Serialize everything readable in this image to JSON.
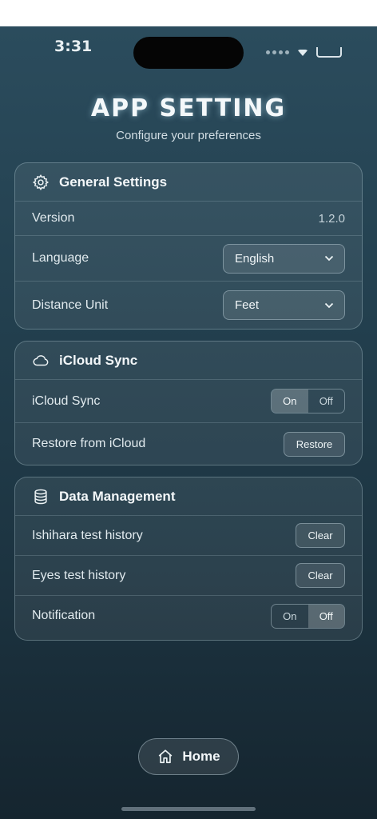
{
  "status_bar": {
    "time": "3:31"
  },
  "header": {
    "title": "APP SETTING",
    "subtitle": "Configure your preferences"
  },
  "general": {
    "title": "General Settings",
    "icon": "gear-icon",
    "version_label": "Version",
    "version_value": "1.2.0",
    "language_label": "Language",
    "language_value": "English",
    "distance_label": "Distance Unit",
    "distance_value": "Feet"
  },
  "icloud": {
    "title": "iCloud Sync",
    "icon": "cloud-icon",
    "sync_label": "iCloud Sync",
    "sync_on": "On",
    "sync_off": "Off",
    "sync_selected": "On",
    "restore_label": "Restore from iCloud",
    "restore_button": "Restore"
  },
  "data": {
    "title": "Data Management",
    "icon": "database-icon",
    "ishihara_label": "Ishihara test history",
    "ishihara_button": "Clear",
    "eyes_label": "Eyes test history",
    "eyes_button": "Clear",
    "notification_label": "Notification",
    "notification_on": "On",
    "notification_off": "Off",
    "notification_selected": "Off"
  },
  "home": {
    "label": "Home",
    "icon": "home-icon"
  },
  "colors": {
    "background_top": "#2b4c5d",
    "background_bottom": "#15252f",
    "text": "#f3f7f9"
  }
}
